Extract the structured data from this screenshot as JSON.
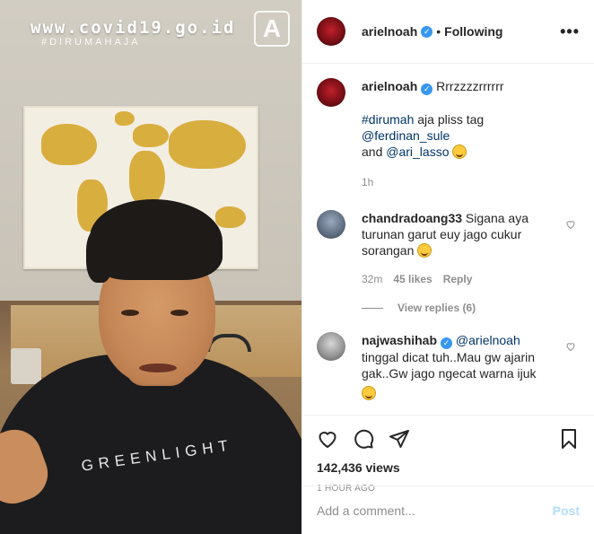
{
  "media": {
    "watermark_url": "www.covid19.go.id",
    "watermark_hashtag": "#DIRUMAHAJA",
    "badge_letter": "A",
    "shirt_text": "GREENLIGHT"
  },
  "header": {
    "username": "arielnoah",
    "separator": "•",
    "follow_status": "Following",
    "more_label": "•••"
  },
  "caption": {
    "username": "arielnoah",
    "text_first": "Rrrzzzzrrrrrr",
    "hashtag": "#dirumah",
    "text_mid": " aja pliss tag ",
    "mention1": "@ferdinan_sule",
    "text_and": "and ",
    "mention2": "@ari_lasso",
    "time": "1h"
  },
  "comments": [
    {
      "username": "chandradoang33",
      "text": "Sigana aya turunan garut euy jago cukur sorangan",
      "time": "32m",
      "likes": "45 likes",
      "reply": "Reply",
      "view_replies": "View replies (6)"
    },
    {
      "username": "najwashihab",
      "mention": "@arielnoah",
      "text": "tinggal dicat tuh..Mau gw ajarin gak..Gw jago ngecat warna ijuk"
    }
  ],
  "stats": {
    "views": "142,436 views",
    "posted": "1 HOUR AGO"
  },
  "composer": {
    "placeholder": "Add a comment...",
    "post_label": "Post"
  },
  "icons": {
    "like": "heart-icon",
    "comment": "comment-icon",
    "share": "paper-plane-icon",
    "save": "bookmark-icon",
    "verified": "verified-badge-icon",
    "more": "more-options-icon"
  },
  "colors": {
    "link": "#003569",
    "verified": "#3897f0",
    "muted": "#8e8e8e",
    "post_disabled": "#b2dffc"
  }
}
